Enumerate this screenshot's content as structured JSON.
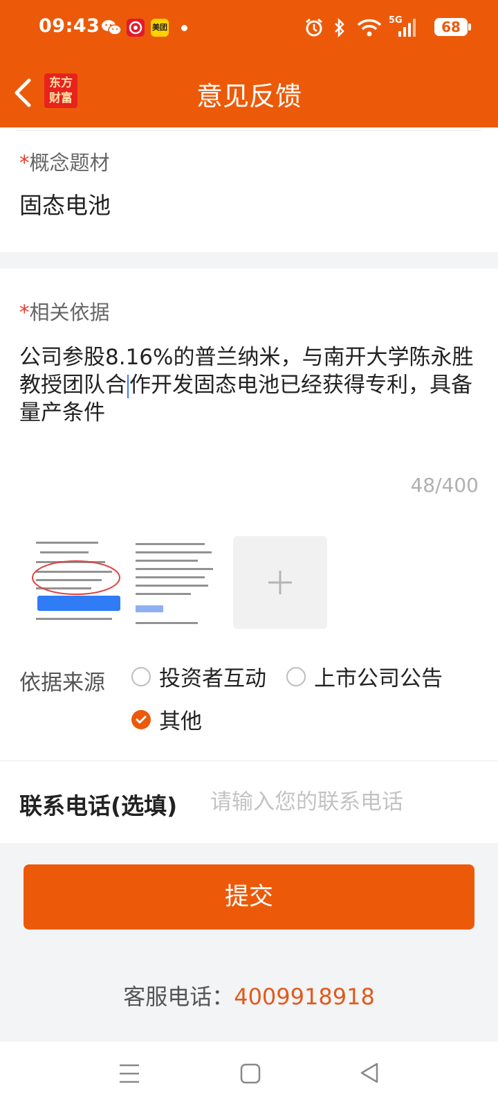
{
  "status_bar": {
    "time": "09:43",
    "meituan_badge": "美团",
    "network": "5G",
    "battery": "68"
  },
  "header": {
    "title": "意见反馈",
    "logo_text": "东方财富"
  },
  "concept": {
    "label": "概念题材",
    "value": "固态电池"
  },
  "basis": {
    "label": "相关依据",
    "text_before_cursor": "公司参股8.16%的普兰纳米，与南开大学陈永胜教授团队合",
    "text_after_cursor": "作开发固态电池已经获得专利，具备量产条件",
    "counter": "48/400"
  },
  "source": {
    "label": "依据来源",
    "options": [
      {
        "label": "投资者互动",
        "checked": false
      },
      {
        "label": "上市公司公告",
        "checked": false
      },
      {
        "label": "其他",
        "checked": true
      }
    ]
  },
  "contact": {
    "label": "联系电话(选填)",
    "placeholder": "请输入您的联系电话",
    "value": ""
  },
  "submit_label": "提交",
  "service": {
    "label": "客服电话：",
    "number": "4009918918"
  },
  "colors": {
    "brand": "#ec5a09",
    "required_star": "#e43b2a"
  },
  "icons": [
    "back-arrow-icon",
    "wechat-icon",
    "app-icon",
    "alarm-icon",
    "bluetooth-icon",
    "wifi-icon",
    "signal-icon",
    "plus-icon",
    "check-icon",
    "menu-icon",
    "home-icon",
    "back-nav-icon"
  ]
}
